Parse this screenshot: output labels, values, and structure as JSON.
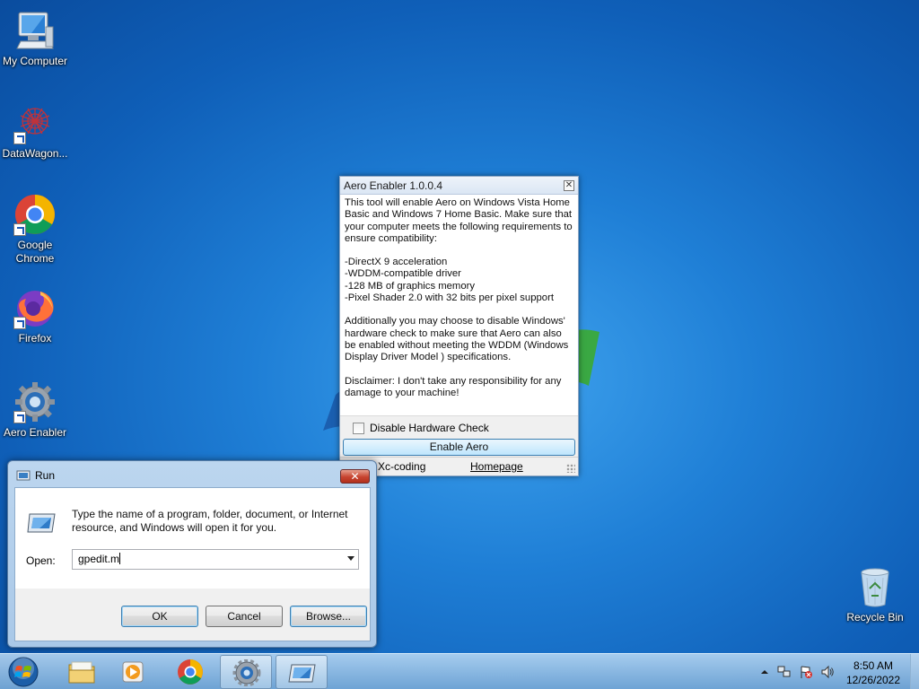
{
  "desktop": {
    "icons": [
      {
        "label": "My Computer",
        "icon": "computer-icon"
      },
      {
        "label": "DataWagon...",
        "icon": "datawagon-icon"
      },
      {
        "label": "Google Chrome",
        "icon": "chrome-icon"
      },
      {
        "label": "Firefox",
        "icon": "firefox-icon"
      },
      {
        "label": "Aero Enabler",
        "icon": "gear-icon"
      },
      {
        "label": "Recycle Bin",
        "icon": "recycle-bin-icon"
      }
    ]
  },
  "aero_window": {
    "title": "Aero Enabler 1.0.0.4",
    "intro": "This tool will enable Aero on Windows Vista Home Basic and Windows 7 Home Basic. Make sure that your computer meets the following requirements to ensure compatibility:",
    "requirements": [
      "-DirectX 9 acceleration",
      "-WDDM-compatible driver",
      "-128 MB of graphics memory",
      "-Pixel Shader 2.0 with 32 bits per pixel support"
    ],
    "additional": "Additionally you may choose to disable Windows' hardware check to make sure that Aero can also be enabled without meeting the WDDM (Windows Display Driver Model ) specifications.",
    "disclaimer": "Disclaimer: I don't take any responsibility for any damage to your machine!",
    "checkbox_label": "Disable Hardware Check",
    "enable_button": "Enable Aero",
    "status_author": "Xc-coding",
    "status_link": "Homepage"
  },
  "run_dialog": {
    "title": "Run",
    "description": "Type the name of a program, folder, document, or Internet resource, and Windows will open it for you.",
    "open_label": "Open:",
    "open_value": "gpedit.m",
    "ok_label": "OK",
    "cancel_label": "Cancel",
    "browse_label": "Browse..."
  },
  "taskbar": {
    "items": [
      "start-orb-icon",
      "file-explorer-icon",
      "media-player-icon",
      "chrome-icon",
      "aero-enabler-icon",
      "run-icon"
    ],
    "time": "8:50 AM",
    "date": "12/26/2022"
  }
}
